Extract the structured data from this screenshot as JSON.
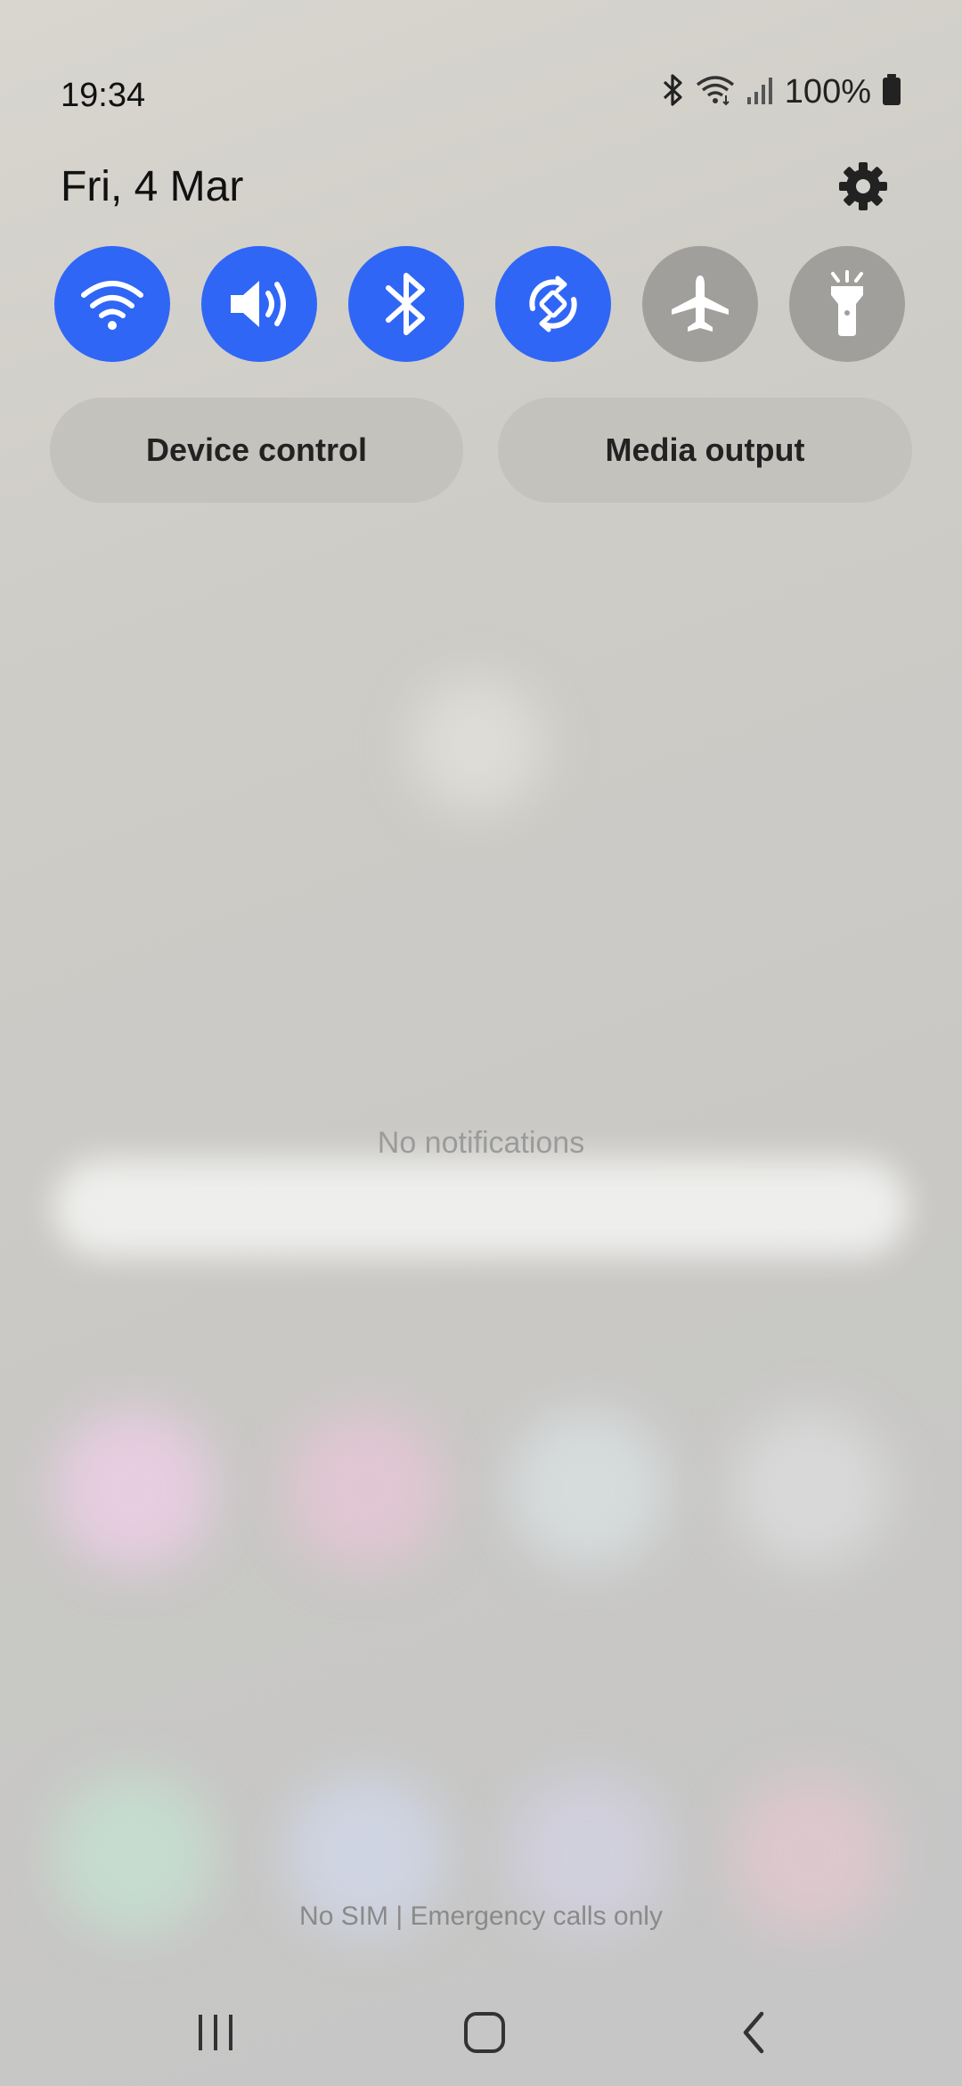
{
  "status_bar": {
    "time": "19:34",
    "battery_percent": "100%",
    "icons": [
      "bluetooth-icon",
      "wifi-icon",
      "signal-icon",
      "battery-icon"
    ]
  },
  "header": {
    "date": "Fri, 4 Mar",
    "settings_icon": "gear-icon"
  },
  "quick_toggles": [
    {
      "name": "wifi",
      "icon": "wifi-icon",
      "state": "on"
    },
    {
      "name": "sound",
      "icon": "speaker-icon",
      "state": "on"
    },
    {
      "name": "bluetooth",
      "icon": "bluetooth-icon",
      "state": "on"
    },
    {
      "name": "auto-rotate",
      "icon": "rotate-icon",
      "state": "on"
    },
    {
      "name": "airplane-mode",
      "icon": "airplane-icon",
      "state": "off"
    },
    {
      "name": "flashlight",
      "icon": "flashlight-icon",
      "state": "off"
    }
  ],
  "buttons": {
    "device_control": "Device control",
    "media_output": "Media output"
  },
  "notifications": {
    "empty_text": "No notifications"
  },
  "footer": {
    "carrier_text": "No SIM | Emergency calls only"
  },
  "nav_bar": {
    "recents_icon": "recents-icon",
    "home_icon": "home-icon",
    "back_icon": "back-icon"
  },
  "colors": {
    "toggle_on": "#2f66f5",
    "toggle_off": "#a09f9c"
  }
}
